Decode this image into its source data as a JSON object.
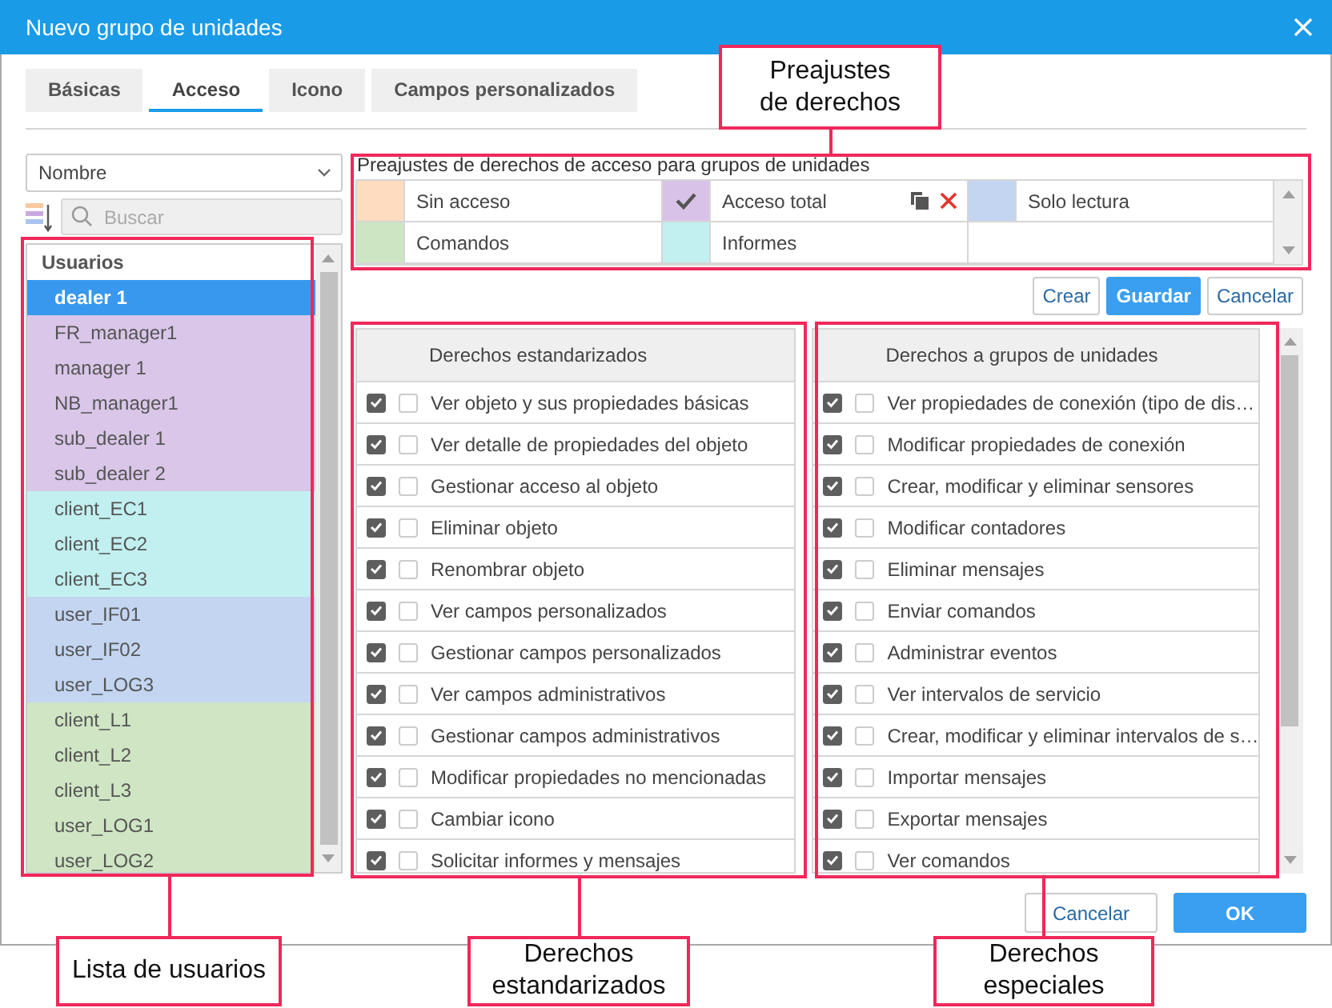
{
  "window": {
    "title": "Nuevo grupo de unidades"
  },
  "tabs": [
    {
      "label": "Básicas",
      "selected": false
    },
    {
      "label": "Acceso",
      "selected": true
    },
    {
      "label": "Icono",
      "selected": false
    },
    {
      "label": "Campos personalizados",
      "selected": false
    }
  ],
  "sort_field": {
    "value": "Nombre"
  },
  "search": {
    "placeholder": "Buscar"
  },
  "user_list": {
    "header": "Usuarios",
    "items": [
      {
        "name": "dealer 1",
        "selected": true
      },
      {
        "name": "FR_manager1",
        "selected": false,
        "color": "#d9c6e8"
      },
      {
        "name": "manager 1",
        "selected": false,
        "color": "#d9c6e8"
      },
      {
        "name": "NB_manager1",
        "selected": false,
        "color": "#d9c6e8"
      },
      {
        "name": "sub_dealer 1",
        "selected": false,
        "color": "#d9c6e8"
      },
      {
        "name": "sub_dealer 2",
        "selected": false,
        "color": "#d9c6e8"
      },
      {
        "name": "client_EC1",
        "selected": false,
        "color": "#c2f0f0"
      },
      {
        "name": "client_EC2",
        "selected": false,
        "color": "#c2f0f0"
      },
      {
        "name": "client_EC3",
        "selected": false,
        "color": "#c2f0f0"
      },
      {
        "name": "user_IF01",
        "selected": false,
        "color": "#c3d5f1"
      },
      {
        "name": "user_IF02",
        "selected": false,
        "color": "#c3d5f1"
      },
      {
        "name": "user_LOG3",
        "selected": false,
        "color": "#c3d5f1"
      },
      {
        "name": "client_L1",
        "selected": false,
        "color": "#cfe5c4"
      },
      {
        "name": "client_L2",
        "selected": false,
        "color": "#cfe5c4"
      },
      {
        "name": "client_L3",
        "selected": false,
        "color": "#cfe5c4"
      },
      {
        "name": "user_LOG1",
        "selected": false,
        "color": "#cfe5c4"
      },
      {
        "name": "user_LOG2",
        "selected": false,
        "color": "#cfe5c4"
      }
    ]
  },
  "presets": {
    "title": "Preajustes de derechos de acceso para grupos de unidades",
    "items": [
      {
        "name": "Sin acceso",
        "color": "#fddcc0",
        "selected": false
      },
      {
        "name": "Acceso total",
        "color": "#d9c2e8",
        "selected": true
      },
      {
        "name": "Solo lectura",
        "color": "#c3d5f1",
        "selected": false
      },
      {
        "name": "Comandos",
        "color": "#cde5c3",
        "selected": false
      },
      {
        "name": "Informes",
        "color": "#c2f0f0",
        "selected": false
      }
    ]
  },
  "preset_actions": [
    {
      "label": "Crear",
      "kind": "default"
    },
    {
      "label": "Guardar",
      "kind": "primary"
    },
    {
      "label": "Cancelar",
      "kind": "default"
    }
  ],
  "standard_rights": {
    "header": "Derechos estandarizados",
    "rows": [
      {
        "label": "Ver objeto y sus propiedades básicas",
        "checked": true,
        "checked_2": false
      },
      {
        "label": "Ver detalle de propiedades del objeto",
        "checked": true,
        "checked_2": false
      },
      {
        "label": "Gestionar acceso al objeto",
        "checked": true,
        "checked_2": false
      },
      {
        "label": "Eliminar objeto",
        "checked": true,
        "checked_2": false
      },
      {
        "label": "Renombrar objeto",
        "checked": true,
        "checked_2": false
      },
      {
        "label": "Ver campos personalizados",
        "checked": true,
        "checked_2": false
      },
      {
        "label": "Gestionar campos personalizados",
        "checked": true,
        "checked_2": false
      },
      {
        "label": "Ver campos administrativos",
        "checked": true,
        "checked_2": false
      },
      {
        "label": "Gestionar campos administrativos",
        "checked": true,
        "checked_2": false
      },
      {
        "label": "Modificar propiedades no mencionadas",
        "checked": true,
        "checked_2": false
      },
      {
        "label": "Cambiar icono",
        "checked": true,
        "checked_2": false
      },
      {
        "label": "Solicitar informes y mensajes",
        "checked": true,
        "checked_2": false
      }
    ]
  },
  "group_rights": {
    "header": "Derechos a grupos de unidades",
    "rows": [
      {
        "label": "Ver propiedades de conexión (tipo de dis…",
        "checked": true,
        "checked_2": false
      },
      {
        "label": "Modificar propiedades de conexión",
        "checked": true,
        "checked_2": false
      },
      {
        "label": "Crear, modificar y eliminar sensores",
        "checked": true,
        "checked_2": false
      },
      {
        "label": "Modificar contadores",
        "checked": true,
        "checked_2": false
      },
      {
        "label": "Eliminar mensajes",
        "checked": true,
        "checked_2": false
      },
      {
        "label": "Enviar comandos",
        "checked": true,
        "checked_2": false
      },
      {
        "label": "Administrar eventos",
        "checked": true,
        "checked_2": false
      },
      {
        "label": "Ver intervalos de servicio",
        "checked": true,
        "checked_2": false
      },
      {
        "label": "Crear, modificar y eliminar intervalos de s…",
        "checked": true,
        "checked_2": false
      },
      {
        "label": "Importar mensajes",
        "checked": true,
        "checked_2": false
      },
      {
        "label": "Exportar mensajes",
        "checked": true,
        "checked_2": false
      },
      {
        "label": "Ver comandos",
        "checked": true,
        "checked_2": false
      }
    ]
  },
  "footer_buttons": [
    {
      "label": "Cancelar",
      "kind": "default"
    },
    {
      "label": "OK",
      "kind": "primary"
    }
  ],
  "annotations": [
    {
      "text": "Preajustes de derechos"
    },
    {
      "text": "Lista de usuarios"
    },
    {
      "text": "Derechos estandarizados"
    },
    {
      "text": "Derechos especiales"
    }
  ]
}
